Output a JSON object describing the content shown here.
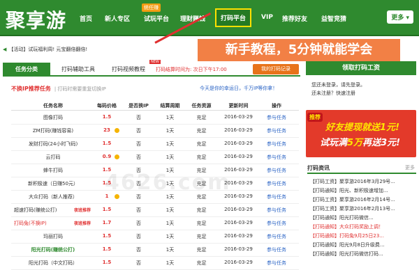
{
  "nav": {
    "logo": "聚享游",
    "items": [
      "首页",
      "新人专区",
      "试玩平台",
      "理财赚钱",
      "打码平台",
      "VIP",
      "推荐好友",
      "益智竞猜"
    ],
    "badge": "统任赚",
    "more": "更多"
  },
  "annotation": "新手教程，5分钟就能学会",
  "notice": {
    "label": "【活动】",
    "text": "试玩福利周! 元宝翻倍翻倍!"
  },
  "tabs": {
    "items": [
      "任务分类",
      "打码辅助工具",
      "打码视频教程"
    ],
    "new_badge": "NEW",
    "time_info": "打码结算时间为: 次日下午17:00",
    "my_record": "我的打码记录"
  },
  "section": {
    "title": "不换IP推荐任务",
    "subtitle": "| 打码时需要重复切换IP",
    "right_link": "今天是你的幸运日，千万IP等你拿！"
  },
  "table": {
    "headers": [
      "任务名称",
      "每码价格",
      "是否换IP",
      "结算周期",
      "任务资源",
      "更新时间",
      "操作"
    ],
    "rows": [
      {
        "name": "图像打码",
        "price": "1.5",
        "coin": false,
        "ip": "否",
        "cycle": "1天",
        "res": "充足",
        "date": "2016-03-29",
        "op": "参与任务",
        "style": ""
      },
      {
        "name": "ZM打码(赚钱容易)",
        "price": "23",
        "coin": true,
        "ip": "否",
        "cycle": "1天",
        "res": "充足",
        "date": "2016-03-29",
        "op": "参与任务",
        "style": ""
      },
      {
        "name": "发财打码(24小时飞码)",
        "price": "1.5",
        "coin": false,
        "ip": "否",
        "cycle": "1天",
        "res": "充足",
        "date": "2016-03-29",
        "op": "参与任务",
        "style": ""
      },
      {
        "name": "云打码",
        "price": "0.9",
        "coin": true,
        "ip": "否",
        "cycle": "1天",
        "res": "充足",
        "date": "2016-03-29",
        "op": "参与任务",
        "style": ""
      },
      {
        "name": "蜂牛打码",
        "price": "1.5",
        "coin": false,
        "ip": "否",
        "cycle": "1天",
        "res": "充足",
        "date": "2016-03-29",
        "op": "参与任务",
        "style": ""
      },
      {
        "name": "新积极速（日赚50元）",
        "price": "1.5",
        "coin": false,
        "ip": "否",
        "cycle": "1天",
        "res": "充足",
        "date": "2016-03-29",
        "op": "参与任务",
        "style": ""
      },
      {
        "name": "大众打码（新人推荐）",
        "price": "1",
        "coin": true,
        "ip": "否",
        "cycle": "1天",
        "res": "充足",
        "date": "2016-03-29",
        "op": "参与任务",
        "style": ""
      },
      {
        "name": "超速打码(赚统公打)",
        "extra": "夜班推荐",
        "price": "1.5",
        "coin": false,
        "ip": "否",
        "cycle": "1天",
        "res": "充足",
        "date": "2016-03-29",
        "op": "参与任务",
        "style": ""
      },
      {
        "name": "打码兔(不换IP)",
        "extra": "夜班推荐",
        "price": "1.7",
        "coin": false,
        "ip": "否",
        "cycle": "1天",
        "res": "充足",
        "date": "2016-03-29",
        "op": "参与任务",
        "style": "red"
      },
      {
        "name": "玛丽打码",
        "price": "1.5",
        "coin": false,
        "ip": "否",
        "cycle": "1天",
        "res": "充足",
        "date": "2016-03-29",
        "op": "参与任务",
        "style": ""
      },
      {
        "name": "阳光打码(赚统公打)",
        "price": "1.5",
        "coin": false,
        "ip": "否",
        "cycle": "1天",
        "res": "充足",
        "date": "2016-03-29",
        "op": "参与任务",
        "style": "green"
      },
      {
        "name": "阳光打码（中文打码）",
        "price": "1.5",
        "coin": false,
        "ip": "否",
        "cycle": "1天",
        "res": "充足",
        "date": "2016-03-29",
        "op": "参与任务",
        "style": ""
      }
    ]
  },
  "watermark": "4626.com",
  "right": {
    "header": "领取打码工资",
    "login_line1": "您还未登录，请先登录。",
    "login_line2": "还未注册？快速注册",
    "banner_tag": "推荐",
    "banner_line1a": "好友",
    "banner_line1b": "提现",
    "banner_line1c": "就送1元!",
    "banner_line2a": "试玩满",
    "banner_line2b": "5万",
    "banner_line2c": "再送3元!",
    "news_title": "打码资讯",
    "news_more": "更多",
    "news": [
      "【打码工资】聚享游2016年3月29号...",
      "【打码通知】阳光、新积极速增加...",
      "【打码工资】聚享游2016年2月14号...",
      "【打码工资】聚享游2016年2月13号...",
      "【打码通知】阳光打码微信...",
      "【打码通知】大众打码奖励上调！",
      "【打码通知】打码兔9月25日23...",
      "【打码通知】阳光9月8日升级费...",
      "【打码通知】阳光打码微信打码..."
    ]
  }
}
